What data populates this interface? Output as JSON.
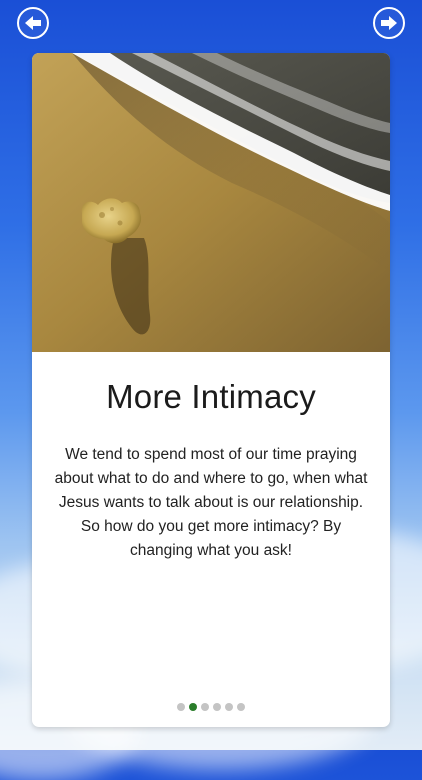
{
  "header": {
    "back_icon": "arrow-left-icon",
    "forward_icon": "arrow-right-icon"
  },
  "card": {
    "image": "stone-on-beach-photo",
    "title": "More Intimacy",
    "body": "We tend to spend most of our time praying about what to do and where to go, when what Jesus wants to talk about is our relationship. So how do you get more intimacy? By changing what you ask!"
  },
  "pager": {
    "total": 6,
    "active_index": 1
  },
  "colors": {
    "sky_top": "#1a4fd6",
    "card_background": "#ffffff",
    "active_dot": "#2a7d2a",
    "inactive_dot": "#c4c4c4"
  }
}
